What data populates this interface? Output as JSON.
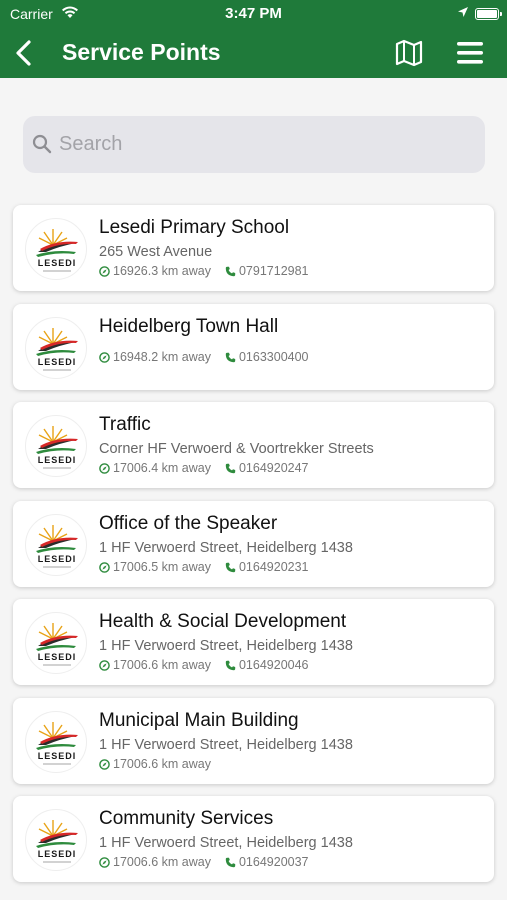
{
  "status_bar": {
    "carrier": "Carrier",
    "time": "3:47 PM"
  },
  "nav": {
    "title": "Service Points"
  },
  "search": {
    "placeholder": "Search",
    "value": ""
  },
  "logo_text": "LESEDI",
  "colors": {
    "brand_green": "#1f7a3a",
    "icon_green": "#2e8b3d"
  },
  "items": [
    {
      "name": "Lesedi Primary School",
      "address": "265 West Avenue",
      "distance": "16926.3 km away",
      "phone": "0791712981"
    },
    {
      "name": "Heidelberg Town Hall",
      "address": "",
      "distance": "16948.2 km away",
      "phone": "0163300400"
    },
    {
      "name": "Traffic",
      "address": "Corner HF Verwoerd & Voortrekker Streets",
      "distance": "17006.4 km away",
      "phone": "0164920247"
    },
    {
      "name": "Office of the Speaker",
      "address": "1 HF Verwoerd Street, Heidelberg 1438",
      "distance": "17006.5 km away",
      "phone": "0164920231"
    },
    {
      "name": "Health & Social Development",
      "address": "1 HF Verwoerd Street, Heidelberg 1438",
      "distance": "17006.6 km away",
      "phone": "0164920046"
    },
    {
      "name": "Municipal Main Building",
      "address": "1 HF Verwoerd Street, Heidelberg 1438",
      "distance": "17006.6 km away",
      "phone": ""
    },
    {
      "name": "Community Services",
      "address": "1 HF Verwoerd Street, Heidelberg 1438",
      "distance": "17006.6 km away",
      "phone": "0164920037"
    }
  ]
}
